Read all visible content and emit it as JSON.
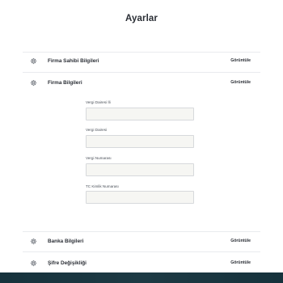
{
  "page": {
    "title": "Ayarlar"
  },
  "sections": [
    {
      "label": "Firma Sahibi Bilgileri",
      "action": "Görüntüle",
      "icon": "gear-icon"
    },
    {
      "label": "Firma Bilgileri",
      "action": "Görüntüle",
      "icon": "gear-icon"
    },
    {
      "label": "Banka Bilgileri",
      "action": "Görüntüle",
      "icon": "gear-icon"
    },
    {
      "label": "Şifre Değişikliği",
      "action": "Görüntüle",
      "icon": "gear-icon"
    }
  ],
  "company_form": {
    "fields": [
      {
        "label": "Vergi Dairesi İli",
        "value": ""
      },
      {
        "label": "Vergi Dairesi",
        "value": ""
      },
      {
        "label": "Vergi Numarası",
        "value": ""
      },
      {
        "label": "TC Kimlik Numarası",
        "value": ""
      }
    ]
  },
  "colors": {
    "text": "#2b2f36",
    "divider": "#e9ebee",
    "input_bg": "#f6f6f3",
    "input_border": "#d7d9dc",
    "bottom_bar": "#1d3a44"
  }
}
